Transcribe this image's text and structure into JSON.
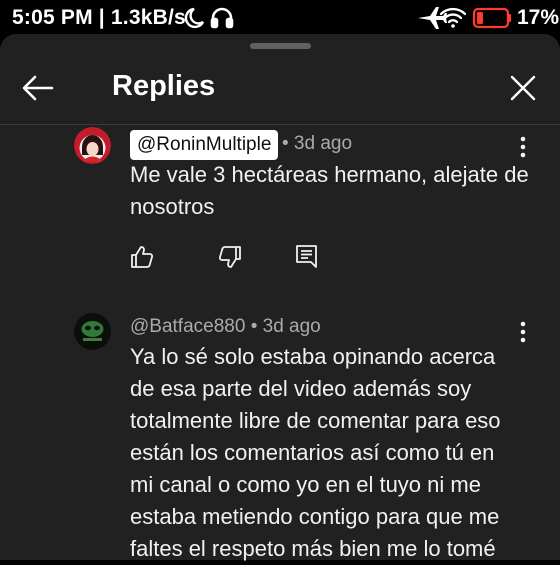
{
  "status_bar": {
    "time": "5:05 PM",
    "network_speed": "1.3kB/s",
    "battery_percent": "17%",
    "icons": [
      "do-not-disturb-moon-icon",
      "headphones-icon",
      "airplane-mode-icon",
      "wifi-icon",
      "battery-low-icon"
    ]
  },
  "header": {
    "title": "Replies",
    "back_icon": "arrow-left-icon",
    "close_icon": "close-icon"
  },
  "comments": [
    {
      "author": "@RoninMultiple",
      "highlighted": true,
      "age": "• 3d ago",
      "lines": [
        "Me vale 3 hectáreas hermano, alejate de",
        "nosotros"
      ],
      "actions": [
        "like-icon",
        "dislike-icon",
        "reply-icon"
      ]
    },
    {
      "author": "@Batface880",
      "highlighted": false,
      "age": "• 3d ago",
      "lines": [
        "Ya lo sé solo estaba opinando acerca",
        "de esa parte del video además soy",
        "totalmente libre de comentar para eso",
        "están los comentarios así como tú en",
        "mi canal o como yo en el tuyo ni me",
        "estaba metiendo contigo para que me",
        "faltes el respeto más bien me lo tomé"
      ]
    }
  ],
  "colors": {
    "background": "#212121",
    "status_bar": "#000000",
    "text": "#f1f1f1",
    "meta": "#aaaaaa",
    "battery_low": "#ff3b30"
  }
}
